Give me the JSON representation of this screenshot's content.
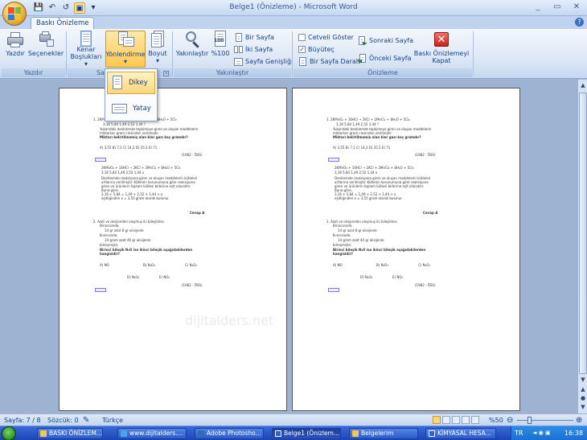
{
  "window": {
    "title": "Belge1 (Önizleme) - Microsoft Word",
    "controls": [
      "_",
      "▭",
      "✕"
    ]
  },
  "quick_access": [
    "💾",
    "↶",
    "↺",
    "▣",
    "▾"
  ],
  "ribbon": {
    "tab": "Baskı Önizleme",
    "groups": {
      "print": {
        "label": "Yazdır",
        "buttons": [
          {
            "name": "yazdir-button",
            "label": "Yazdır",
            "icon": "printer-icon"
          },
          {
            "name": "secenekler-button",
            "label": "Seçenekler",
            "icon": "options-icon"
          }
        ]
      },
      "page_setup": {
        "label_start": "Sa",
        "kenar": {
          "line1": "Kenar",
          "line2": "Boşlukları ▾"
        },
        "yonlendirme": {
          "label": "Yönlendirme",
          "arrow": "▾"
        },
        "boyut": {
          "label": "Boyut",
          "arrow": "▾"
        }
      },
      "zoom": {
        "label": "Yakınlaştır",
        "yakinlastir": "Yakınlaştır",
        "percent": "%100",
        "bir_sayfa": "Bir Sayfa",
        "iki_sayfa": "İki Sayfa",
        "sayfa_genisligi": "Sayfa Genişliği"
      },
      "preview": {
        "label": "Önizleme",
        "cetveli_goster": "Cetveli Göster",
        "buyutec": "Büyüteç",
        "bir_sayfa_daralt": "Bir Sayfa Daralt",
        "sonraki_sayfa": "Sonraki Sayfa",
        "onceki_sayfa": "Önceki Sayfa",
        "close_line1": "Baskı Önizlemeyi",
        "close_line2": "Kapat",
        "cetvel_checked": false,
        "buyutec_checked": true
      }
    }
  },
  "orientation_menu": {
    "items": [
      {
        "label": "Dikey",
        "selected": true
      },
      {
        "label": "Yatay",
        "selected": false
      }
    ]
  },
  "pages": {
    "q1_eq": "1.    2KMnO₄ + 16HCl → 2KCl + 2MnCl₂ + 8H₂O + 5Cl₂",
    "q1_nums": "3,16      5,84     1,49     2,52      1,44      ?",
    "q1_l1": "Yukarıdaki denklemde tepkimeye giren ve oluşan maddelerin",
    "q1_l2": "miktarları gram cinsinden verilmiştir.",
    "q1_bold": "Miktarı belirtilmemiş olan klor gazı kaç gramdır?",
    "q1_opts": "A) 3,55        B) 7,1        C) 14,2        D) 35,5        E) 71",
    "q1_year": "(1982 - ÖSS)",
    "sol_eq": "2KMnO₄ + 16HCl → 2KCl + 2MnCl₂ + 8H₂O + 5Cl₂",
    "sol_nums": "3,16       5,84      1,49      2,52      1,44      x",
    "sol_l1": "Denklemde reaksiyona giren ve oluşan maddelerin kütleleri",
    "sol_l2": "artlarına verilmiştir. Kütlenin korunumuna göre reaksiyona",
    "sol_l3": "giren ve ürünlerin toplam kütlesi birbirine eşit olacaktır.",
    "sol_l4": "Buna göre,",
    "sol_l5": "3,16 + 5,84 = 1,49 + 2,52 + 1,44 + x",
    "sol_l6": "eşitliğinden x = 3,55 gram olarak bulunur.",
    "answer": "Cevap A",
    "q2_l1": "2.    Azot ve oksijenden oluşmuş iki bileşikten;",
    "q2_l2": "Birincisinde,",
    "q2_l3": "14 gr azot 8 gr oksijenle",
    "q2_l4": "İkincisinde,",
    "q2_l5": "14 gram azot 40 gr oksijenle",
    "q2_l6": "birleşmiştir.",
    "q2_bold1": "Birinci bileşik N₂O ise ikinci bileşik aşağıdakilerden",
    "q2_bold2": "hangisidir?",
    "q2_optA": "A) NO",
    "q2_optB": "B) N₂O₃",
    "q2_optC": "C) N₂O₃",
    "q2_optD": "D) N₂O₄",
    "q2_optE": "E) NO₂",
    "q2_year": "(1982 - ÖSS)",
    "watermark": "dijitalders.net"
  },
  "statusbar": {
    "page": "Sayfa: 7 / 8",
    "words": "Sözcük: 0",
    "lang": "Türkçe",
    "zoom": "%50",
    "zoom_level": 0.5
  },
  "taskbar": {
    "tasks": [
      {
        "label": "BASKI ÖNİZLEM...",
        "color": "#f2c94c",
        "active": false
      },
      {
        "label": "www.dijitalders....",
        "color": "#4aa3e8",
        "active": false
      },
      {
        "label": "Adobe Photosho...",
        "color": "#2b6fb6",
        "active": false
      },
      {
        "label": "Belge1 (Önizlem...",
        "color": "#2f63c6",
        "active": true
      },
      {
        "label": "Belgelerim",
        "color": "#f2c94c",
        "active": false
      },
      {
        "label": "KİMYASAL HESA...",
        "color": "#2f63c6",
        "active": false
      }
    ],
    "lang": "TR",
    "time": "16:38"
  },
  "colors": {
    "ribbon_highlight": "#ffd67a",
    "close_button": "#d9322c",
    "doc_background": "#9eb3d1"
  }
}
